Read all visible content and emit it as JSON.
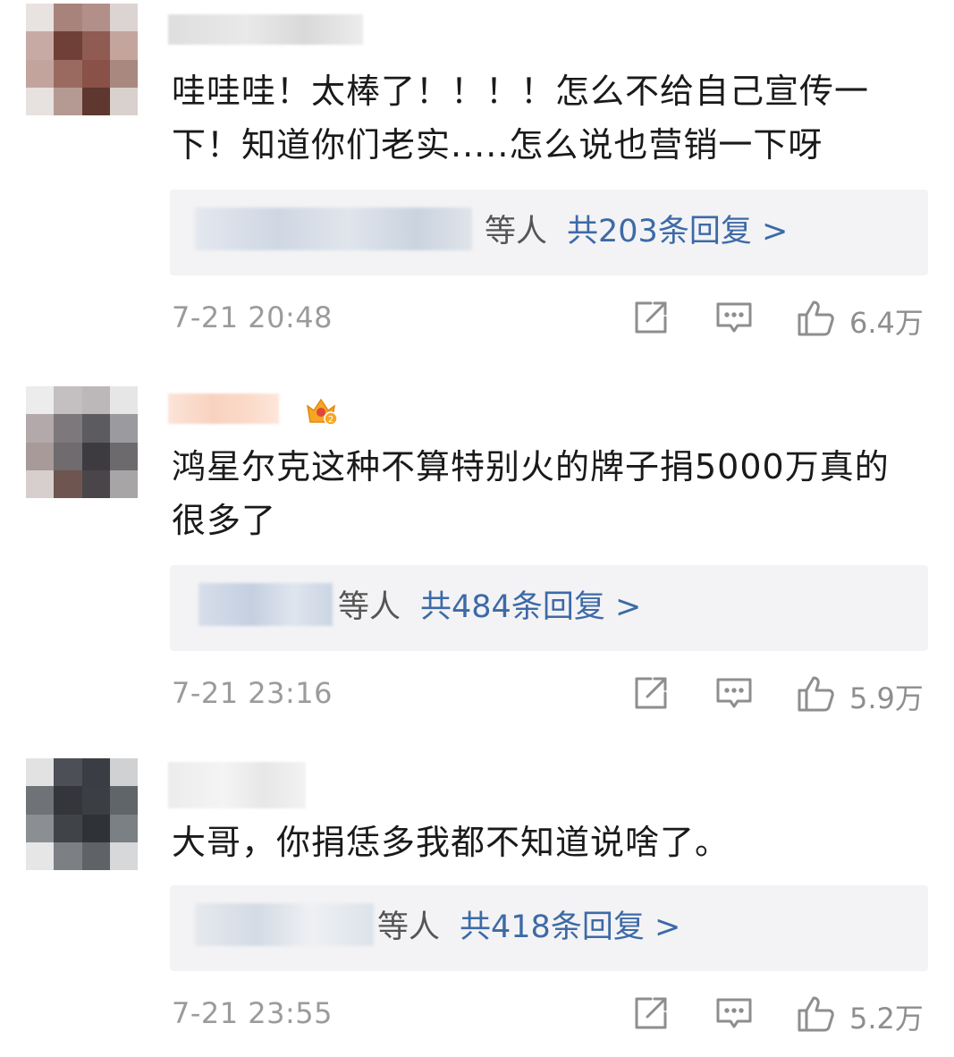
{
  "comments": [
    {
      "text": "哇哇哇！太棒了！！！！怎么不给自己宣传一下！知道你们老实.....怎么说也营销一下呀",
      "reply_suffix": "等人",
      "reply_count": "共203条回复 >",
      "time": "7-21 20:48",
      "likes": "6.4万",
      "has_badge": false
    },
    {
      "text": "鸿星尔克这种不算特别火的牌子捐5000万真的很多了",
      "reply_suffix": "等人",
      "reply_count": "共484条回复 >",
      "time": "7-21 23:16",
      "likes": "5.9万",
      "has_badge": true
    },
    {
      "text": "大哥，你捐恁多我都不知道说啥了。",
      "reply_suffix": "等人",
      "reply_count": "共418条回复 >",
      "time": "7-21 23:55",
      "likes": "5.2万",
      "has_badge": false
    }
  ],
  "icons": {
    "share": "share-icon",
    "comment": "comment-icon",
    "like": "thumbs-up-icon",
    "badge": "crown-badge-icon"
  },
  "colors": {
    "link": "#3d6aa6",
    "meta": "#9b9b9b",
    "reply_bg": "#f3f3f5",
    "badge": "#f5a623"
  }
}
